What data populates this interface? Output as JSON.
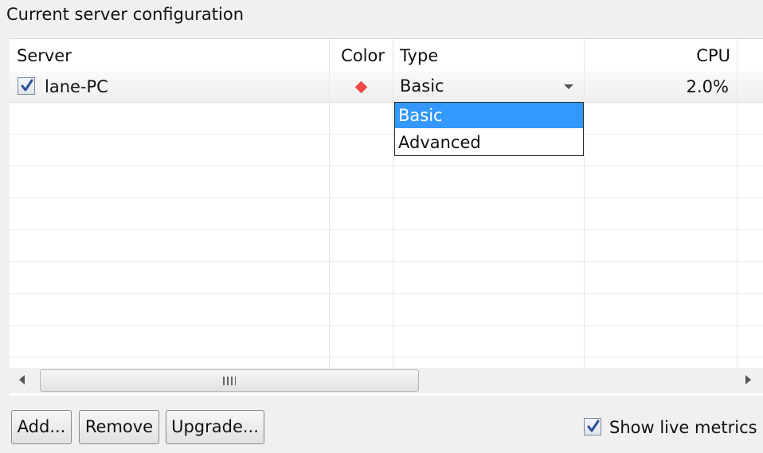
{
  "group_title": "Current server configuration",
  "table": {
    "columns": [
      "Server",
      "Color",
      "Type",
      "CPU"
    ],
    "rows": [
      {
        "checked": true,
        "server": "lane-PC",
        "color": "#f04848",
        "type": "Basic",
        "cpu": "2.0%"
      }
    ]
  },
  "type_dropdown": {
    "options": [
      "Basic",
      "Advanced"
    ],
    "selected": "Basic"
  },
  "scrollbar_grip": "III",
  "buttons": {
    "add": "Add...",
    "remove": "Remove",
    "upgrade": "Upgrade..."
  },
  "live_metrics": {
    "label": "Show live metrics",
    "checked": true
  }
}
